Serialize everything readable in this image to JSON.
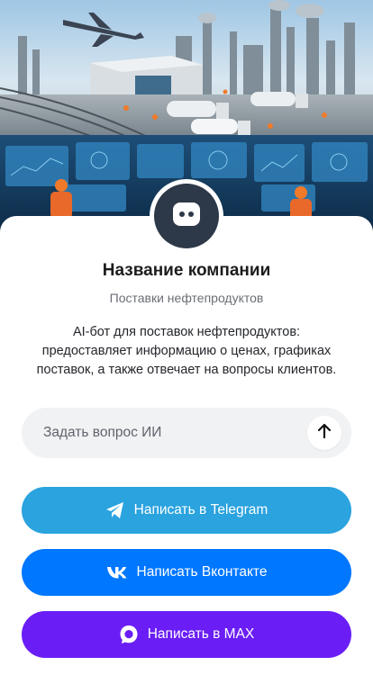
{
  "profile": {
    "company_name": "Название компании",
    "subtitle": "Поставки нефтепродуктов",
    "description": "AI-бот для поставок нефтепродуктов: предоставляет информацию о ценах, графиках поставок, а также отвечает на вопросы клиентов.",
    "avatar_icon": "chat-bubble-icon"
  },
  "ask": {
    "placeholder": "Задать вопрос ИИ",
    "send_icon": "arrow-up-icon"
  },
  "buttons": {
    "telegram": {
      "label": "Написать в Telegram",
      "icon": "telegram-icon",
      "color": "#2aa3df"
    },
    "vk": {
      "label": "Написать Вконтакте",
      "icon": "vk-icon",
      "color": "#0077ff"
    },
    "max": {
      "label": "Написать в MAX",
      "icon": "max-icon",
      "color": "#6a1ef5"
    }
  },
  "colors": {
    "avatar_bg": "#2d3848",
    "input_bg": "#f1f2f4"
  }
}
